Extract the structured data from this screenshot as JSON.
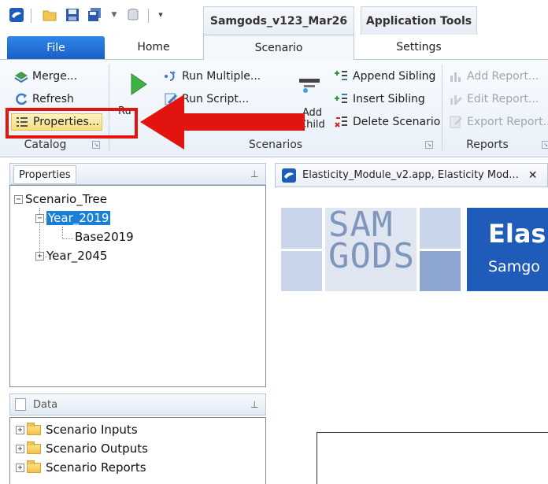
{
  "quick_access": {
    "icons": [
      "app-icon",
      "open-folder-icon",
      "save-icon",
      "save-all-icon",
      "dropdown-arrow-icon",
      "database-icon",
      "customize-icon"
    ]
  },
  "contextual_groups": {
    "scenario_group": "Samgods_v123_Mar26",
    "tools_group": "Application Tools"
  },
  "ribbon_tabs": {
    "file": "File",
    "home": "Home",
    "scenario": "Scenario",
    "settings": "Settings"
  },
  "ribbon": {
    "catalog": {
      "label": "Catalog",
      "merge": "Merge...",
      "refresh": "Refresh",
      "properties": "Properties..."
    },
    "scenarios": {
      "label": "Scenarios",
      "run_truncated": "Ru",
      "run_multiple": "Run Multiple...",
      "run_script": "Run Script...",
      "add_child": "Add Child",
      "add_child_line1": "Add",
      "add_child_line2": "Child",
      "append_sibling": "Append Sibling",
      "insert_sibling": "Insert Sibling",
      "delete_scenario": "Delete Scenario"
    },
    "reports": {
      "label": "Reports",
      "add_report": "Add Report...",
      "edit_report": "Edit Report...",
      "export_report": "Export Report..."
    }
  },
  "properties_panel": {
    "tab_label": "Properties",
    "tree": {
      "root": "Scenario_Tree",
      "year_2019": "Year_2019",
      "base_2019": "Base2019",
      "year_2045": "Year_2045"
    }
  },
  "data_panel": {
    "title": "Data",
    "items": [
      "Scenario Inputs",
      "Scenario Outputs",
      "Scenario Reports"
    ]
  },
  "document": {
    "tab_title": "Elasticity_Module_v2.app, Elasticity Mod...",
    "banner_logo_line1": "SAM",
    "banner_logo_line2": "GODS",
    "banner_title": "Elas",
    "banner_subtitle": "Samgo"
  },
  "colors": {
    "file_tab": "#1a5fc7",
    "selection": "#1b7fd6",
    "annotation": "#e2140f",
    "banner": "#1f5bb8"
  }
}
